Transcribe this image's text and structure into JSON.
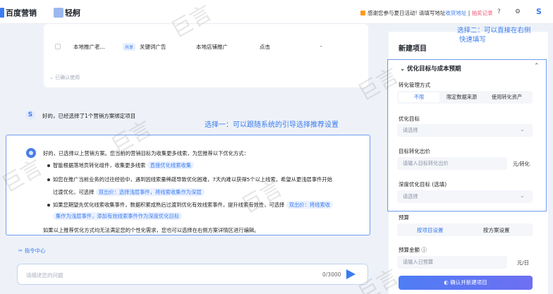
{
  "topbar": {
    "brand": "百度营销",
    "product": "轻舸",
    "notice_text": "感谢您参与夏日活动! 请填写地址",
    "notice_link": "收货地址",
    "notice_sep": " | ",
    "notice_link2": "抽奖记录",
    "help_icon": "?",
    "settings_icon": "⚙",
    "user_initial": "S"
  },
  "plan_table": {
    "row": {
      "name": "本地推广老...",
      "share_tag": "共享",
      "type": "关键词广告",
      "scene": "本地店铺推广",
      "goal": "点击",
      "extra": "-"
    },
    "confirm_used": "已确认使用"
  },
  "chat": {
    "user_badge": "S",
    "bot_message": "好的，已经选择了1个营销方案绑定项目",
    "annotation_left": "选择一：可以跟随系统的引导选择推荐设置",
    "ai_intro": "好的，已选择以上营销方案。您当前的营销目标为收集更多线索，为您推荐以下优化方式：",
    "bullets": [
      {
        "text": "智能根据落地页转化组件，收集更多线索",
        "tag": "直接优化线索收集"
      },
      {
        "text_line1": "如您在推广当前业务的过往经验中，遇到因线索量稀疏导致优化困难，7天内难以获得5个以上线索，希望从更浅层事件开始",
        "text_line2": "过渡优化，可选择",
        "tag": "双出价：选择浅层事件，将线索收集作为深层"
      },
      {
        "text_line1": "如果您期望先优化线索收集事件，数据积累成熟后过渡到优化有效线索事件，提升线索有效性，可选择",
        "tag_line1": "双出价：将线索收",
        "tag_line2": "集作为浅层事件，添加有效线索事件作为深度优化目标"
      }
    ],
    "closing": "如果以上推荐优化方式均无法满足您的个性化需求，您也可以选择在右侧方案详情区进行编辑。",
    "command_center": "指令中心",
    "input_placeholder": "请描述您的问题",
    "counter": "0/3000"
  },
  "right_panel": {
    "title": "新建项目",
    "annotation_right_line1": "选择二：可以直接在右侧",
    "annotation_right_line2": "快速填写",
    "section_title": "优化目标与成本预期",
    "conversion_mgmt_label": "转化管理方式",
    "conversion_options": [
      "不限",
      "限定数据来源",
      "使用转化资产"
    ],
    "conversion_selected": "不限",
    "opt_goal_label": "优化目标",
    "opt_goal_placeholder": "请选择",
    "target_bid_label": "目标转化出价",
    "target_bid_placeholder": "请输入目标转化出价",
    "target_bid_unit": "元/转化",
    "deep_goal_label": "深度优化目标 (选填)",
    "deep_goal_placeholder": "请选择",
    "budget_section": "预算",
    "budget_options": [
      "按项目设置",
      "按方案设置"
    ],
    "budget_selected": "按项目设置",
    "budget_amount_label": "预算金额 ⓘ",
    "budget_amount_placeholder": "请输入日预算",
    "budget_amount_unit": "元/日",
    "confirm_button": "确认并新建项目"
  },
  "watermark_text": "巨言",
  "colors": {
    "accent": "#3a7bf0",
    "highlight_border": "#6e9cf0",
    "notice_orange": "#ff9a1f",
    "notice_pink": "#f05a7a"
  }
}
